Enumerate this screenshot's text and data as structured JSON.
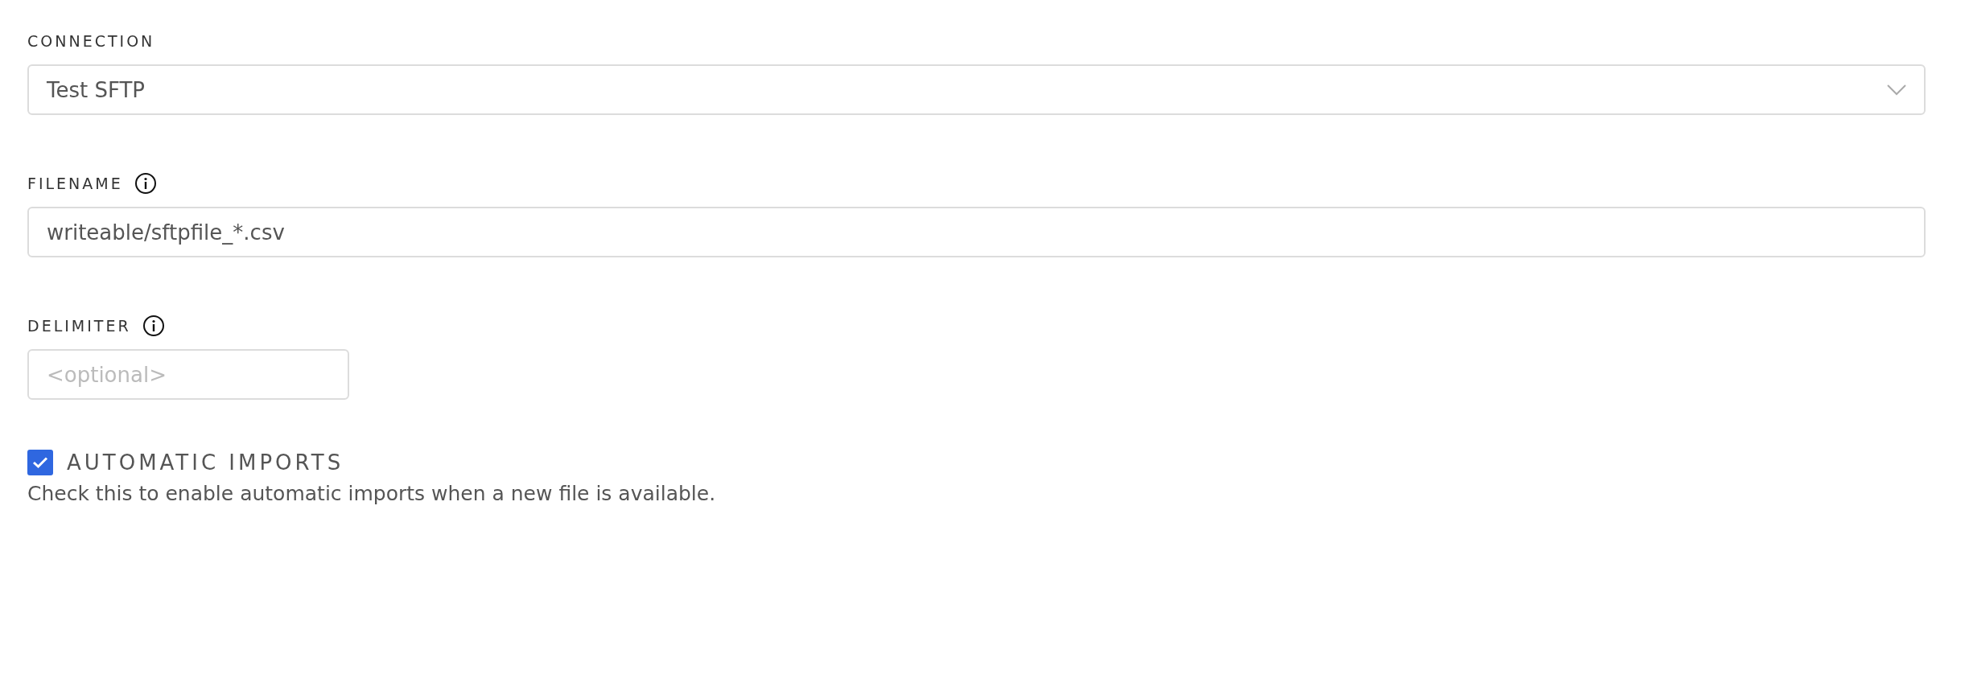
{
  "fields": [
    {
      "kind": "select",
      "label": "CONNECTION",
      "info": false,
      "value": "Test SFTP"
    },
    {
      "kind": "text",
      "label": "FILENAME",
      "info": true,
      "value": "writeable/sftpfile_*.csv"
    },
    {
      "kind": "short",
      "label": "DELIMITER",
      "info": true,
      "placeholder": "<optional>"
    }
  ],
  "automatic_imports": {
    "label": "AUTOMATIC IMPORTS",
    "checked": true,
    "description": "Check this to enable automatic imports when a new file is available."
  }
}
